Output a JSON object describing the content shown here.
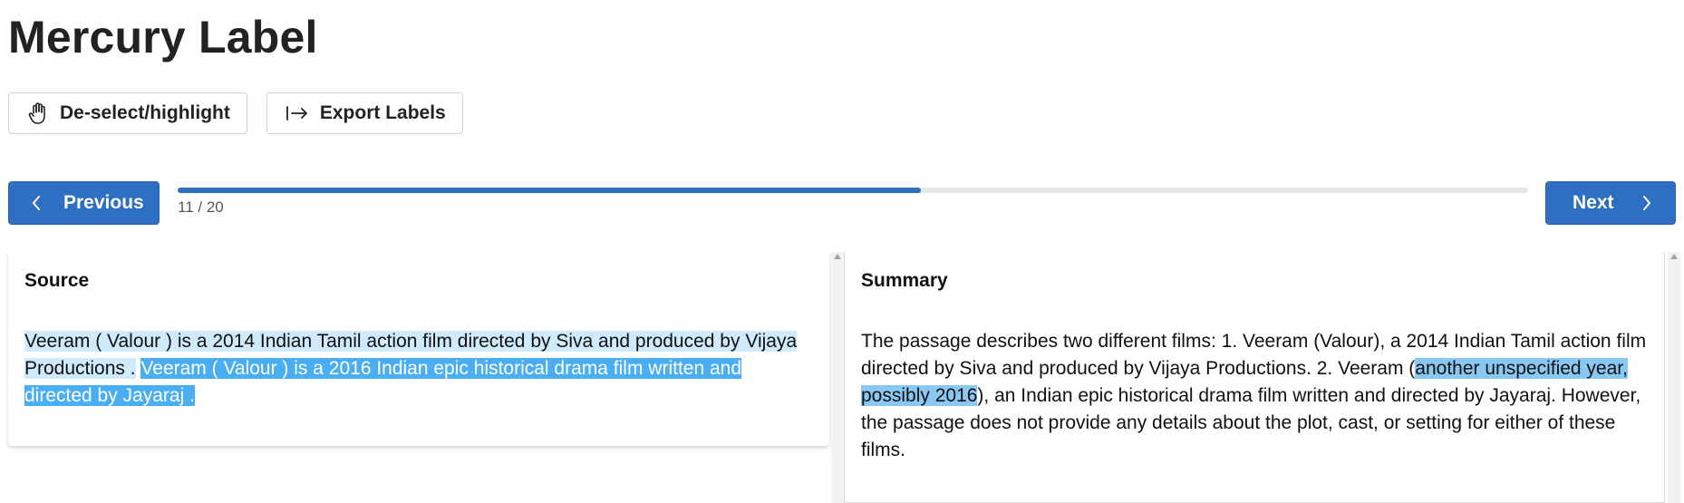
{
  "app": {
    "title": "Mercury Label"
  },
  "toolbar": {
    "deselect_label": "De-select/highlight",
    "export_label": "Export Labels"
  },
  "navigation": {
    "previous_label": "Previous",
    "next_label": "Next",
    "progress_text": "11 / 20",
    "progress_fraction": 0.55
  },
  "source": {
    "title": "Source",
    "segment_1": "Veeram ( Valour ) is a 2014 Indian Tamil action film directed by Siva and produced by Vijaya Productions .",
    "segment_2": "Veeram ( Valour ) is a 2016 Indian epic historical drama film written and directed by Jayaraj ."
  },
  "summary": {
    "title": "Summary",
    "text_before": "The passage describes two different films: 1. Veeram (Valour), a 2014 Indian Tamil action film directed by Siva and produced by Vijaya Productions. 2. Veeram (",
    "highlighted": "another unspecified year, possibly 2016",
    "text_after": "), an Indian epic historical drama film written and directed by Jayaraj. However, the passage does not provide any details about the plot, cast, or setting for either of these films."
  },
  "colors": {
    "accent": "#2e6fc1",
    "highlight_light": "#cfeafb",
    "highlight_strong": "#4aaef5",
    "highlight_mid": "#89c8f3"
  },
  "icons": {
    "deselect": "hand-icon",
    "export": "export-arrow-icon",
    "previous": "chevron-left-icon",
    "next": "chevron-right-icon"
  }
}
